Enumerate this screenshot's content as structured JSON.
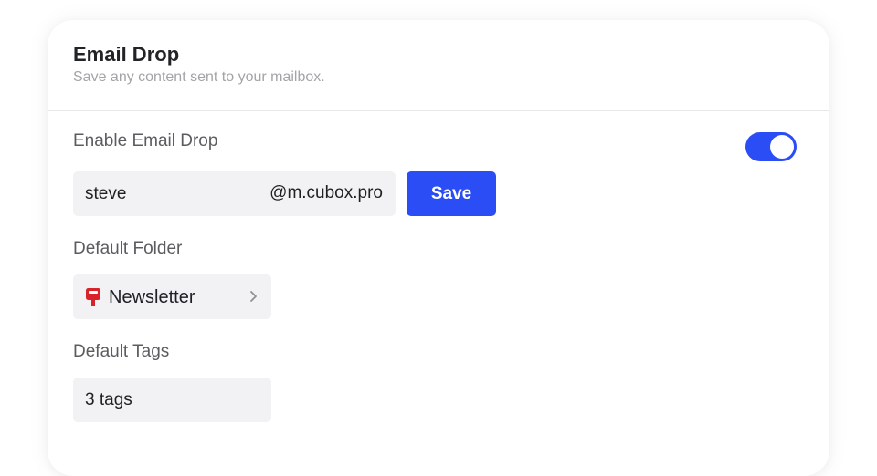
{
  "panel": {
    "title": "Email Drop",
    "subtitle": "Save any content sent to your mailbox."
  },
  "email_drop": {
    "enable_label": "Enable Email Drop",
    "enabled": true,
    "username": "steve",
    "domain": "@m.cubox.pro",
    "save_label": "Save"
  },
  "default_folder": {
    "label": "Default Folder",
    "value": "Newsletter",
    "icon": "mailbox-icon"
  },
  "default_tags": {
    "label": "Default Tags",
    "value": "3 tags"
  },
  "colors": {
    "accent": "#2b4df5",
    "field_bg": "#f2f2f4",
    "mailbox_icon": "#d8232a"
  }
}
